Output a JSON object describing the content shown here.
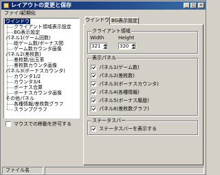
{
  "window": {
    "title": "レイアウトの変更と保存",
    "controls": {
      "minimize": "_",
      "maximize": "□",
      "close": "×"
    }
  },
  "menu": {
    "items": [
      "ファイル",
      "初期化"
    ]
  },
  "tree": {
    "items": [
      "ウインドウ",
      "クライアント領域表示設定",
      "BG表示設定",
      "パネル1(ゲーム回数)",
      "総ゲーム数/ボーナス間",
      "ゲーム数カウンタ画像",
      "パネル2(差枚数)",
      "差枚数/出玉率",
      "差枚数カウンタ画像",
      "パネル3(ボーナスカウンタ)",
      "カウンタ1/2",
      "カウンタ3/4",
      "ボーナス合算",
      "ボーナスカウンタ画像",
      "その他パネル",
      "各種情報/差枚数グラフ",
      "スランプグラフ"
    ]
  },
  "mouse_move_label": "マウスでの移動を許可する",
  "mouse_move_checked": false,
  "tabs": [
    "ウインドウ",
    "BG表示設定"
  ],
  "client_area": {
    "title": "クライアント領域",
    "width_label": "Width",
    "height_label": "Height",
    "width_value": "321",
    "height_value": "320"
  },
  "display_panels": {
    "title": "表示パネル",
    "items": [
      {
        "label": "パネル1(ゲーム数)",
        "checked": true
      },
      {
        "label": "パネル2(差枚数)",
        "checked": true
      },
      {
        "label": "パネル3(ボーナスカウンタ)",
        "checked": true
      },
      {
        "label": "パネル4(各種情報)",
        "checked": true
      },
      {
        "label": "パネル5(ボーナス履歴)",
        "checked": true
      },
      {
        "label": "パネル6(差枚数グラフ)",
        "checked": true
      }
    ]
  },
  "statusbar_group": {
    "title": "ステータスバー",
    "label": "ステータスバーを表示する",
    "checked": true
  },
  "statusbar": {
    "file_name_label": "ファイル名"
  }
}
